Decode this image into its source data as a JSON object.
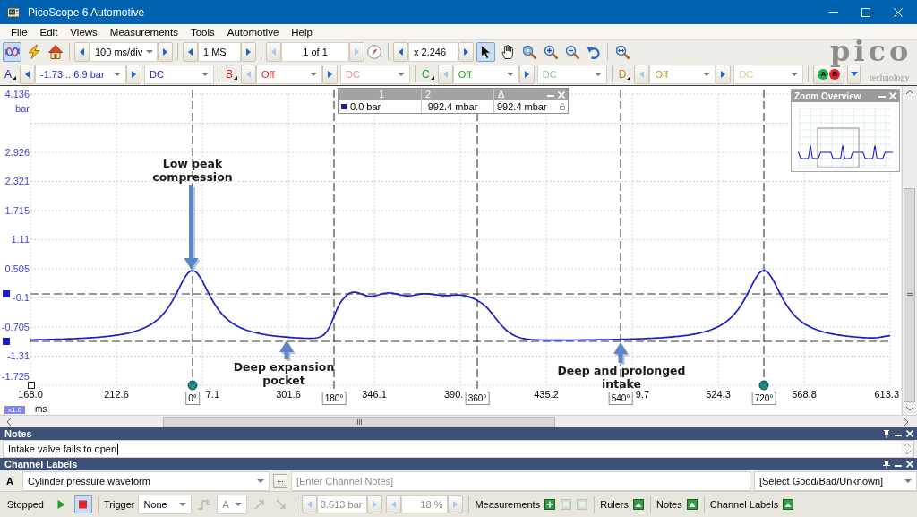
{
  "window": {
    "title": "PicoScope 6 Automotive"
  },
  "menu": [
    "File",
    "Edit",
    "Views",
    "Measurements",
    "Tools",
    "Automotive",
    "Help"
  ],
  "toolbar": {
    "mode_tools": [
      {
        "kind": "wave",
        "selected": true
      },
      {
        "kind": "bolt",
        "selected": false
      },
      {
        "kind": "house",
        "selected": false
      }
    ],
    "timebase": "100 ms/div",
    "samples": "1 MS",
    "buffer": {
      "value": "1 of 1",
      "disabled": true
    },
    "zoom": "x 2.246",
    "view_tools": [
      {
        "kind": "pointer",
        "selected": true
      },
      {
        "kind": "hand",
        "selected": false
      },
      {
        "kind": "zoomrect",
        "selected": false
      },
      {
        "kind": "zoomin",
        "selected": false
      },
      {
        "kind": "zoomout",
        "selected": false
      },
      {
        "kind": "undo",
        "selected": false
      },
      {
        "kind": "zoomfit",
        "selected": false
      }
    ],
    "logo": {
      "word": "pico",
      "tagline": "technology"
    }
  },
  "channels": [
    {
      "name": "A",
      "color": "#2424d0",
      "range": "-1.73 .. 6.9 bar",
      "coupling": "DC",
      "enabled": true
    },
    {
      "name": "B",
      "color": "#e01e1e",
      "range": "Off",
      "coupling": "DC",
      "enabled": false
    },
    {
      "name": "C",
      "color": "#1e9e1e",
      "range": "Off",
      "coupling": "DC",
      "enabled": false
    },
    {
      "name": "D",
      "color": "#b8902a",
      "range": "Off",
      "coupling": "DC",
      "enabled": false
    }
  ],
  "indicators": [
    {
      "label": "A",
      "color": "#22b14c"
    },
    {
      "label": "B",
      "color": "#e0202a"
    }
  ],
  "scope": {
    "y_unit": "bar",
    "y_ticks": [
      "4.136",
      "2.926",
      "2.321",
      "1.715",
      "1.11",
      "0.505",
      "-0.1",
      "-0.705",
      "-1.31",
      "-1.725"
    ],
    "x_ticks": [
      {
        "label": "168.0",
        "kind": "full"
      },
      {
        "label": "212.6",
        "kind": "full"
      },
      {
        "label": "7.1",
        "kind": "tail"
      },
      {
        "label": "301.6",
        "kind": "full"
      },
      {
        "label": "346.1",
        "kind": "full"
      },
      {
        "label": "390.",
        "kind": "head"
      },
      {
        "label": "435.2",
        "kind": "full"
      },
      {
        "label": "9.7",
        "kind": "tail"
      },
      {
        "label": "524.3",
        "kind": "full"
      },
      {
        "label": "568.8",
        "kind": "full"
      },
      {
        "label": "613.3",
        "kind": "full"
      }
    ],
    "x_unit": "ms",
    "x_scale": "x1.0",
    "rotation_labels": [
      "0°",
      "180°",
      "360°",
      "540°",
      "720°"
    ],
    "annotations": [
      {
        "text": "Low peak compression",
        "kind": "down"
      },
      {
        "text": "Deep expansion pocket",
        "kind": "up"
      },
      {
        "text": "Deep and prolonged intake",
        "kind": "up"
      }
    ],
    "ruler_table": {
      "columns": [
        "1",
        "2",
        "Δ"
      ],
      "values": [
        "0.0 bar",
        "-992.4 mbar",
        "992.4 mbar"
      ]
    },
    "zoom_overview": {
      "title": "Zoom Overview"
    }
  },
  "notes": {
    "title": "Notes",
    "value": "Intake valve fails to open"
  },
  "channel_labels": {
    "title": "Channel Labels",
    "rows": [
      {
        "channel": "A",
        "label": "Cylinder pressure waveform",
        "more": "...",
        "notes": {
          "placeholder": "[Enter Channel Notes]"
        },
        "rating": "[Select Good/Bad/Unknown]"
      }
    ]
  },
  "status_bar": {
    "state": "Stopped",
    "run_controls": [
      {
        "kind": "run",
        "selected": false
      },
      {
        "kind": "stop",
        "selected": true
      }
    ],
    "trigger_label": "Trigger",
    "trigger_mode": "None",
    "trigger_icon": {
      "disabled": true
    },
    "trigger_source": {
      "value": "A",
      "disabled": true
    },
    "trigger_edges": [
      {
        "kind": "rise",
        "disabled": true
      },
      {
        "kind": "fall",
        "disabled": true
      }
    ],
    "threshold": {
      "value": "3.513 bar",
      "disabled": true
    },
    "pretrigger": {
      "value": "18 %",
      "disabled": true
    },
    "measurements": {
      "label": "Measurements",
      "actions": [
        {
          "kind": "plus",
          "disabled": false
        },
        {
          "kind": "tile",
          "disabled": true
        },
        {
          "kind": "tile",
          "disabled": true
        }
      ]
    },
    "toggles": [
      {
        "label": "Rulers"
      },
      {
        "label": "Notes"
      },
      {
        "label": "Channel Labels"
      }
    ]
  }
}
